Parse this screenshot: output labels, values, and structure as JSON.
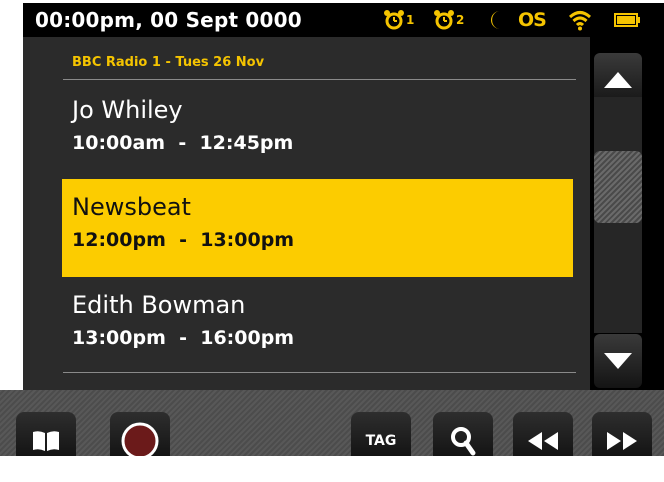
{
  "status_bar": {
    "clock": "00:00pm, 00 Sept 0000",
    "icons": [
      "alarm-1-icon",
      "alarm-2-icon",
      "sleep-moon-icon",
      "os-icon",
      "wifi-icon",
      "battery-icon"
    ],
    "alarm1_label": "1",
    "alarm2_label": "2",
    "os_label": "OS"
  },
  "schedule": {
    "station_header": "BBC Radio 1 - Tues 26 Nov",
    "items": [
      {
        "name": "Jo Whiley",
        "time": "10:00am  -  12:45pm",
        "selected": false
      },
      {
        "name": "Newsbeat",
        "time": "12:00pm  -  13:00pm",
        "selected": true
      },
      {
        "name": "Edith Bowman",
        "time": "13:00pm  -  16:00pm",
        "selected": false
      }
    ]
  },
  "scrollbar": {
    "up_icon": "triangle-up-icon",
    "down_icon": "triangle-down-icon"
  },
  "toolbar": {
    "buttons": [
      "book-icon",
      "record-icon",
      "tag-button",
      "search-icon",
      "rewind-icon",
      "fast-forward-icon"
    ],
    "tag_label": "TAG"
  },
  "colors": {
    "accent_yellow": "#fccc00",
    "header_yellow": "#f5c400",
    "record_red": "#6b1a1a",
    "panel_bg": "#2b2b2b"
  }
}
